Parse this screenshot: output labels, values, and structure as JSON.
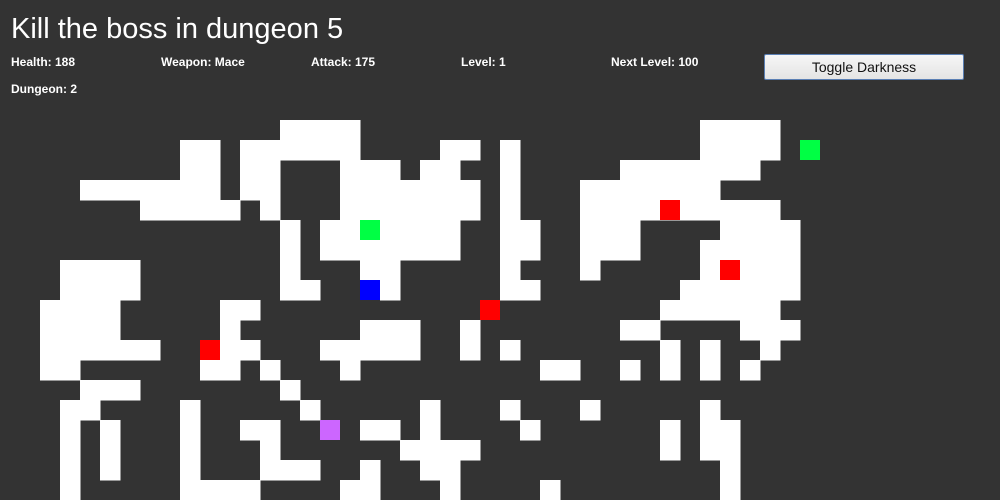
{
  "game": {
    "title": "Kill the boss in dungeon 5"
  },
  "stats": {
    "health": "Health: 188",
    "weapon": "Weapon: Mace",
    "attack": "Attack: 175",
    "level": "Level: 1",
    "next_level": "Next Level: 100",
    "dungeon": "Dungeon: 2"
  },
  "controls": {
    "toggle_darkness_label": "Toggle Darkness"
  },
  "map": {
    "floor_rows": [
      "........................................",
      "........................................",
      "........................................",
      "........................................",
      "........................................",
      "........................................",
      "..............####.................####.",
      ".........##.######....##.#.........####.",
      ".........##.##...###.##..#.....#######..",
      "....#######.##...#######.#...#######....",
      ".......#####.#...#######.#...##########.",
      "..............#.#######..##..###....####",
      "..............#.#######..##..###...#####",
      "...####.......#...##.....#...#.....#####",
      "...####.......##...#.....##.......######",
      "..####.....##....................######.",
      "..####.....#......###..#.......##....###",
      "..######...##...#####..#.#.......#.#..#.",
      "..##......##.#...#.........##..#.#.#.#..",
      "....###.......#.........................",
      "...##....#.....#.....#...#...#.....#....",
      "...#.#...#..##....##.#....#......#.##...",
      "...#.#...#...#......####.........#.##...",
      "...#.#...#...###..#..##.............#...",
      "...#.....####....##...#....#........#...",
      "..........##.....................#.....#"
    ],
    "entities": [
      {
        "type": "player",
        "row": 14,
        "col": 18,
        "color": "#0000ff"
      },
      {
        "type": "enemy",
        "row": 10,
        "col": 33,
        "color": "#ff0000"
      },
      {
        "type": "enemy",
        "row": 13,
        "col": 36,
        "color": "#ff0000"
      },
      {
        "type": "enemy",
        "row": 15,
        "col": 24,
        "color": "#ff0000"
      },
      {
        "type": "enemy",
        "row": 17,
        "col": 10,
        "color": "#ff0000"
      },
      {
        "type": "health",
        "row": 7,
        "col": 40,
        "color": "#00ff44"
      },
      {
        "type": "health",
        "row": 11,
        "col": 18,
        "color": "#00ff44"
      },
      {
        "type": "weapon",
        "row": 21,
        "col": 16,
        "color": "#cc66ff"
      }
    ],
    "colors": {
      "wall": "#333333",
      "floor": "#ffffff"
    }
  }
}
